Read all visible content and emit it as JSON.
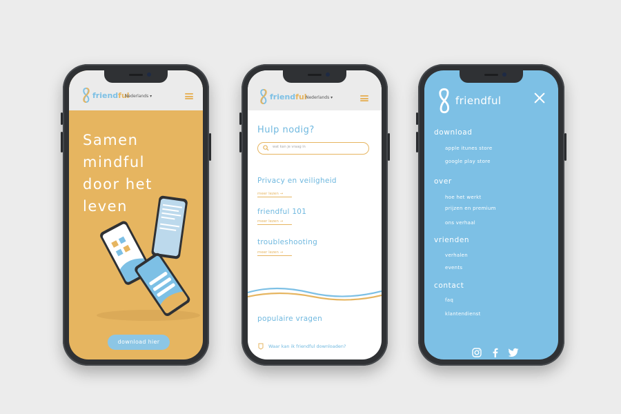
{
  "brand": {
    "name": "friendful",
    "name_prefix": "friend",
    "name_suffix": "ful",
    "colors": {
      "blue": "#7dc0e5",
      "yellow": "#e6b560",
      "dark_blue": "#6fb8df",
      "frame": "#2f3134"
    }
  },
  "phone1": {
    "language": "Nederlands",
    "hero_lines": [
      "Samen",
      "mindful",
      "door het",
      "leven"
    ],
    "download_button": "download hier"
  },
  "phone2": {
    "language": "Nederlands",
    "help_title": "Hulp nodig?",
    "search_placeholder": "wat kan je vraag in",
    "sections": [
      {
        "title": "Privacy en veiligheid",
        "more": "meer lezen →"
      },
      {
        "title": "friendful 101",
        "more": "meer lezen →"
      },
      {
        "title": "troubleshooting",
        "more": "meer lezen →"
      }
    ],
    "popular_title": "populaire vragen",
    "faq_item": "Waar kan ik friendful downloaden?"
  },
  "phone3": {
    "menu": [
      {
        "heading": "download",
        "items": [
          "apple itunes store",
          "google play store"
        ]
      },
      {
        "heading": "over",
        "items": [
          "hoe het werkt",
          "prijzen en premium",
          "ons verhaal"
        ]
      },
      {
        "heading": "vrienden",
        "items": [
          "verhalen",
          "events"
        ]
      },
      {
        "heading": "contact",
        "items": [
          "faq",
          "klantendienst"
        ]
      }
    ],
    "social_icons": [
      "instagram-icon",
      "facebook-icon",
      "twitter-icon"
    ]
  }
}
